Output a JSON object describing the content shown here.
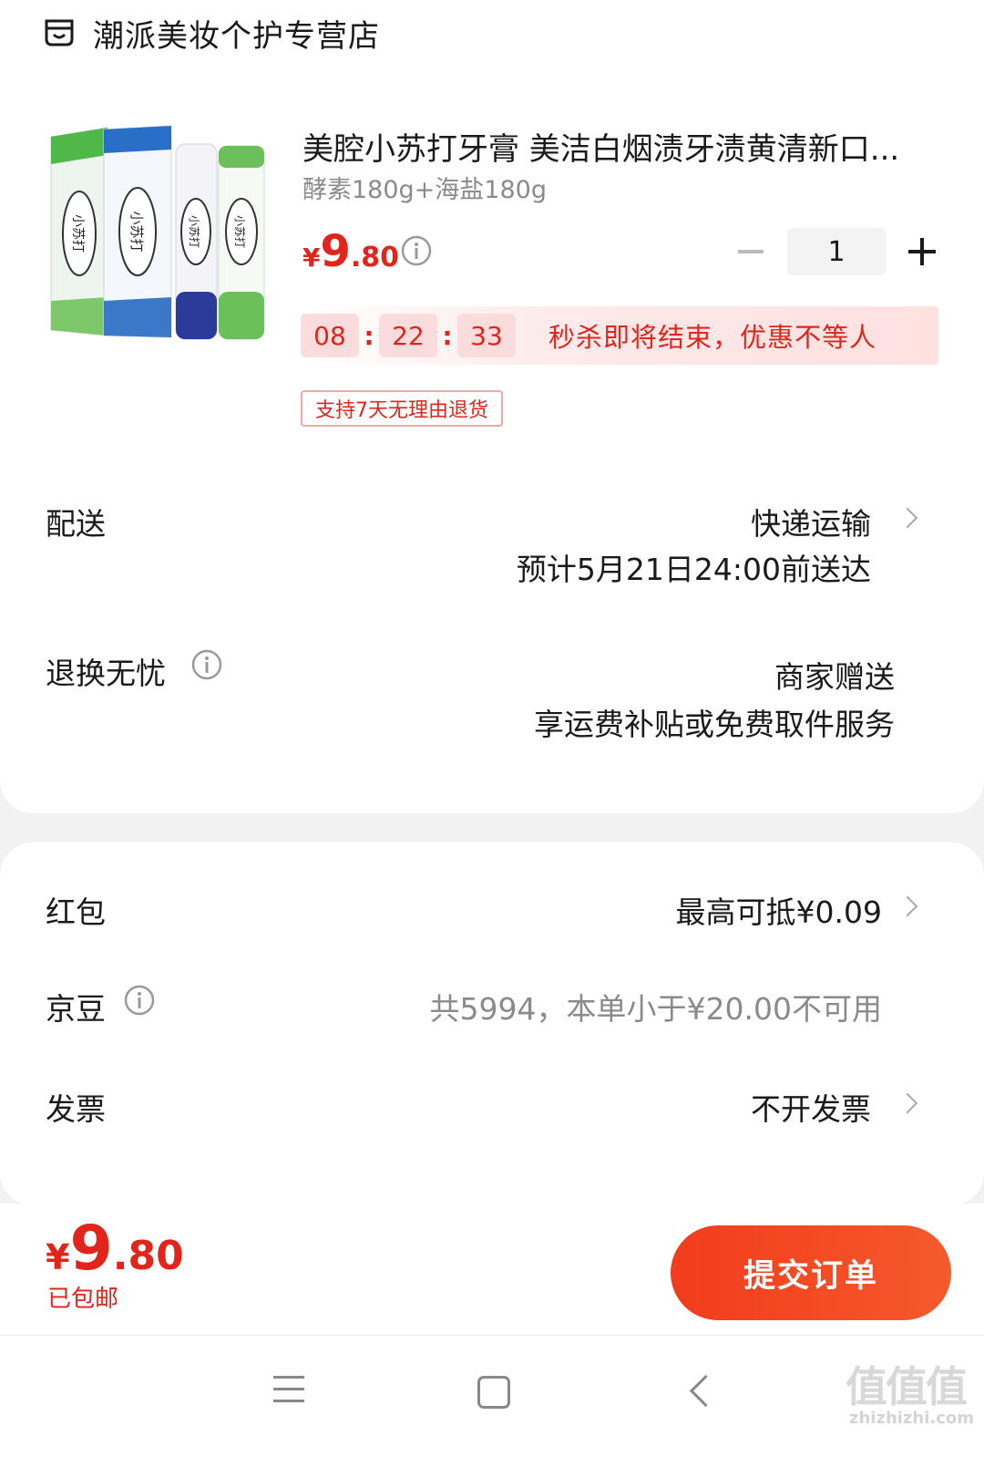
{
  "shop": {
    "name": "潮派美妆个护专营店",
    "icon": "shop-icon"
  },
  "product": {
    "title": "美腔小苏打牙膏 美洁白烟渍牙渍黄清新口...",
    "spec": "酵素180g+海盐180g",
    "price": {
      "yen": "¥",
      "int": "9",
      "dec": ".80"
    },
    "qty": "1",
    "img_label": "小苏打",
    "image_colors": [
      "#4fb849",
      "#2a6fc7",
      "#2c3a9a",
      "#6cc05a"
    ]
  },
  "seckill": {
    "h": "08",
    "m": "22",
    "s": "33",
    "sep": ":",
    "text": "秒杀即将结束，优惠不等人"
  },
  "return_tag": "支持7天无理由退货",
  "delivery": {
    "label": "配送",
    "method": "快递运输",
    "eta": "预计5月21日24:00前送达"
  },
  "returns": {
    "label": "退换无忧",
    "line1": "商家赠送",
    "line2": "享运费补贴或免费取件服务"
  },
  "redpacket": {
    "label": "红包",
    "value": "最高可抵¥0.09"
  },
  "jingdou": {
    "label": "京豆",
    "value": "共5994，本单小于¥20.00不可用"
  },
  "invoice": {
    "label": "发票",
    "value": "不开发票"
  },
  "bottom": {
    "yen": "¥",
    "int": "9",
    "dec": ".80",
    "shipping": "已包邮",
    "submit": "提交订单"
  },
  "watermark": {
    "main": "值值值",
    "sub": "zhizhizhi.com"
  },
  "colors": {
    "accent": "#e1251b",
    "button": "#f23c1b"
  }
}
